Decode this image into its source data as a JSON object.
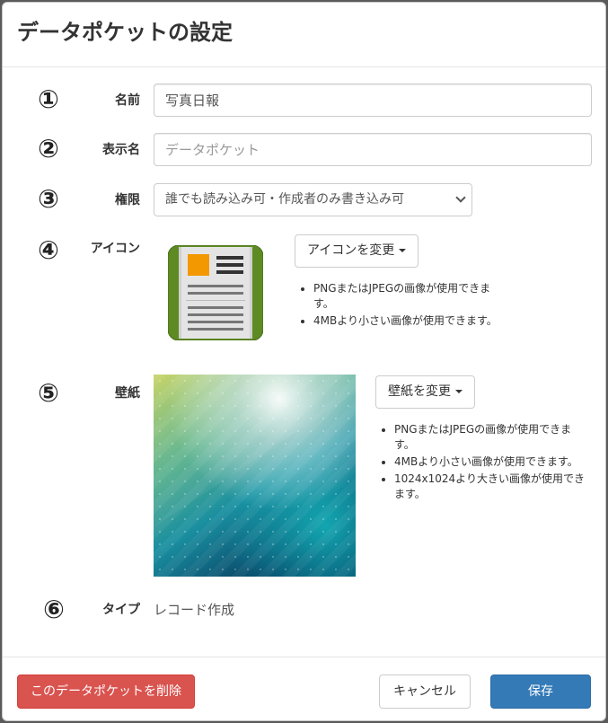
{
  "modal": {
    "title": "データポケットの設定"
  },
  "form": {
    "name": {
      "num": "①",
      "label": "名前",
      "value": "写真日報"
    },
    "display_name": {
      "num": "②",
      "label": "表示名",
      "placeholder": "データポケット"
    },
    "permission": {
      "num": "③",
      "label": "権限",
      "selected": "誰でも読み込み可・作成者のみ書き込み可"
    },
    "icon": {
      "num": "④",
      "label": "アイコン",
      "change_label": "アイコンを変更",
      "notes": [
        "PNGまたはJPEGの画像が使用できます。",
        "4MBより小さい画像が使用できます。"
      ],
      "icon_name": "newspaper-icon",
      "colors": {
        "accent": "#f39800",
        "binding": "#5e8a23",
        "paper": "#e4e4e4"
      }
    },
    "wallpaper": {
      "num": "⑤",
      "label": "壁紙",
      "change_label": "壁紙を変更",
      "notes": [
        "PNGまたはJPEGの画像が使用できます。",
        "4MBより小さい画像が使用できます。",
        "1024x1024より大きい画像が使用できます。"
      ],
      "colors": {
        "top_left": "#c9d56a",
        "middle": "#1ea0a0",
        "bottom": "#063a5e"
      }
    },
    "type": {
      "num": "⑥",
      "label": "タイプ",
      "value": "レコード作成"
    }
  },
  "footer": {
    "delete_label": "このデータポケットを削除",
    "cancel_label": "キャンセル",
    "save_label": "保存"
  },
  "colors": {
    "danger": "#d9534f",
    "primary": "#337ab7"
  }
}
